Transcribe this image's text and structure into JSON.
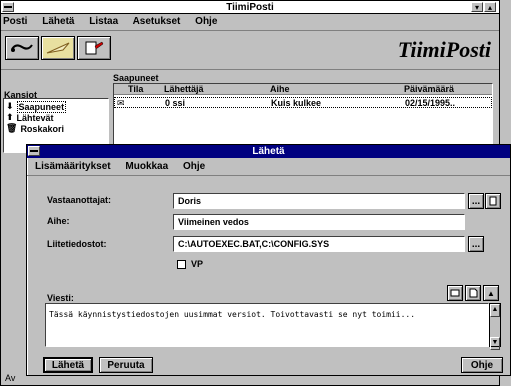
{
  "main_window": {
    "title": "TiimiPosti",
    "logo_text": "TiimiPosti",
    "menu": [
      "Posti",
      "Lähetä",
      "Listaa",
      "Asetukset",
      "Ohje"
    ],
    "toolbar_icons": [
      "phone-hook-icon",
      "feather-pen-icon",
      "edit-copy-icon"
    ]
  },
  "folders": {
    "header": "Kansiot",
    "items": [
      "Saapuneet",
      "Lähtevät",
      "Roskakori"
    ]
  },
  "message_list": {
    "title": "Saapuneet",
    "columns": [
      "Tila",
      "Lähettäjä",
      "Aihe",
      "Päivämäärä"
    ],
    "rows": [
      {
        "sender": "0 ssi",
        "subject": "Kuis kulkee",
        "date": "02/15/1995.."
      }
    ]
  },
  "send_dialog": {
    "title": "Lähetä",
    "menu": [
      "Lisämääritykset",
      "Muokkaa",
      "Ohje"
    ],
    "recipients_label": "Vastaanottajat:",
    "recipients_value": "Doris",
    "subject_label": "Aihe:",
    "subject_value": "Viimeinen vedos",
    "attachments_label": "Liitetiedostot:",
    "attachments_value": "C:\\AUTOEXEC.BAT,C:\\CONFIG.SYS",
    "vip_label": "VP",
    "message_label": "Viesti:",
    "message_text": "Tässä käynnistystiedostojen uusimmat versiot. Toivottavasti se nyt toimii...",
    "send_button": "Lähetä",
    "cancel_button": "Peruuta",
    "help_button": "Ohje",
    "ellipsis": "..."
  },
  "taskbar_fragment": "Av"
}
